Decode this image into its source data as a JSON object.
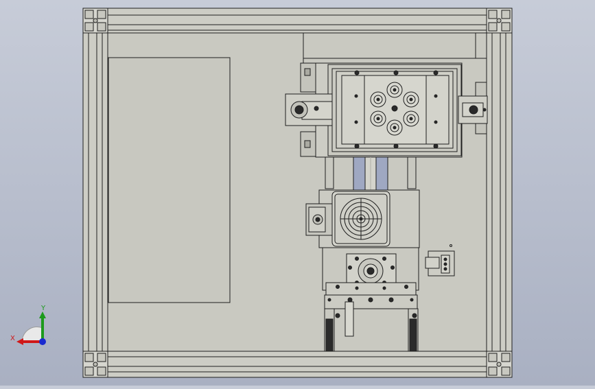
{
  "viewport": {
    "background_top": "#c7ccd8",
    "background_bottom": "#a9b0c2",
    "model_fill": "#c9c9c1",
    "line_color": "#1e1e1e"
  },
  "triad": {
    "x_label": "X",
    "y_label": "Y",
    "x_color": "#d01818",
    "y_color": "#1c9a1c",
    "z_color": "#1a2ad0"
  }
}
